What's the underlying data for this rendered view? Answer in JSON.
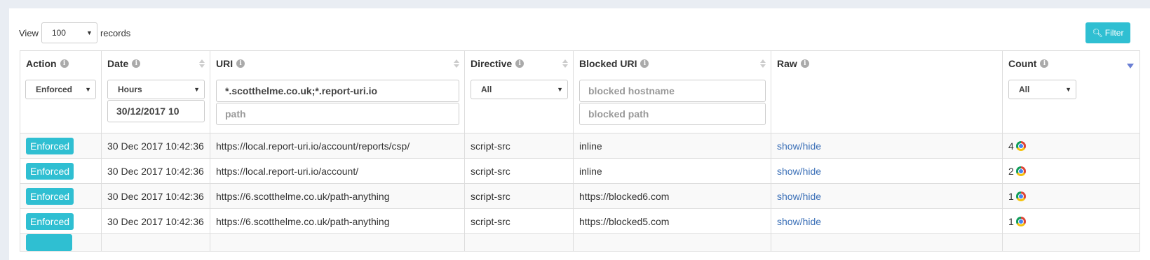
{
  "toolbar": {
    "view_label": "View",
    "view_value": "100",
    "records_label": "records",
    "filter_label": "Filter"
  },
  "columns": [
    {
      "key": "action",
      "label": "Action"
    },
    {
      "key": "date",
      "label": "Date"
    },
    {
      "key": "uri",
      "label": "URI"
    },
    {
      "key": "directive",
      "label": "Directive"
    },
    {
      "key": "blocked_uri",
      "label": "Blocked URI"
    },
    {
      "key": "raw",
      "label": "Raw"
    },
    {
      "key": "count",
      "label": "Count"
    }
  ],
  "filters": {
    "action_select": "Enforced",
    "date_select": "Hours",
    "date_value": "30/12/2017 10",
    "uri_value": "*.scotthelme.co.uk;*.report-uri.io",
    "path_placeholder": "path",
    "directive_select": "All",
    "blocked_hostname_placeholder": "blocked hostname",
    "blocked_path_placeholder": "blocked path",
    "count_select": "All"
  },
  "rows": [
    {
      "action": "Enforced",
      "date": "30 Dec 2017 10:42:36",
      "uri": "https://local.report-uri.io/account/reports/csp/",
      "directive": "script-src",
      "blocked_uri": "inline",
      "raw": "show/hide",
      "count": "4",
      "browser_icon": "chrome-icon"
    },
    {
      "action": "Enforced",
      "date": "30 Dec 2017 10:42:36",
      "uri": "https://local.report-uri.io/account/",
      "directive": "script-src",
      "blocked_uri": "inline",
      "raw": "show/hide",
      "count": "2",
      "browser_icon": "chrome-icon"
    },
    {
      "action": "Enforced",
      "date": "30 Dec 2017 10:42:36",
      "uri": "https://6.scotthelme.co.uk/path-anything",
      "directive": "script-src",
      "blocked_uri": "https://blocked6.com",
      "raw": "show/hide",
      "count": "1",
      "browser_icon": "chrome-icon"
    },
    {
      "action": "Enforced",
      "date": "30 Dec 2017 10:42:36",
      "uri": "https://6.scotthelme.co.uk/path-anything",
      "directive": "script-src",
      "blocked_uri": "https://blocked5.com",
      "raw": "show/hide",
      "count": "1",
      "browser_icon": "chrome-icon"
    }
  ],
  "colors": {
    "accent": "#2fbfd2",
    "link": "#3a6fb7",
    "sort_active": "#6a7fd4"
  }
}
